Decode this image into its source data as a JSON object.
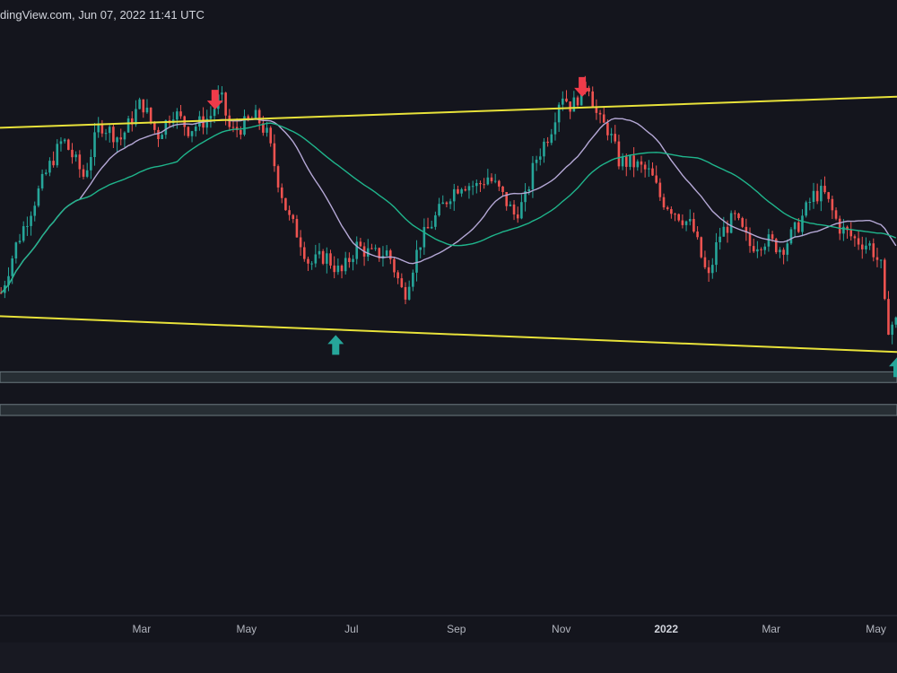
{
  "watermark": "dingView.com, Jun 07, 2022 11:41 UTC",
  "colors": {
    "background": "#14151d",
    "up": "#26a69a",
    "down": "#ef5350",
    "channel": "#e8e23a",
    "ma_fast": "#b5a8d6",
    "ma_slow": "#1fb58c",
    "zone": "#2a3338",
    "arrow_up": "#26a69a",
    "arrow_down": "#ef3b4a"
  },
  "chart_data": {
    "type": "candlestick",
    "title": "",
    "xlabel": "",
    "ylabel": "",
    "x_ticks": [
      {
        "label": "Mar",
        "t": 2.0,
        "bold": false
      },
      {
        "label": "May",
        "t": 4.0,
        "bold": false
      },
      {
        "label": "Jul",
        "t": 6.0,
        "bold": false
      },
      {
        "label": "Sep",
        "t": 8.0,
        "bold": false
      },
      {
        "label": "Nov",
        "t": 10.0,
        "bold": false
      },
      {
        "label": "2022",
        "t": 12.0,
        "bold": true
      },
      {
        "label": "Mar",
        "t": 14.0,
        "bold": false
      },
      {
        "label": "May",
        "t": 16.0,
        "bold": false
      }
    ],
    "x_range": [
      -0.7,
      16.4
    ],
    "y_range": [
      0,
      100
    ],
    "price_path": [
      [
        -0.7,
        20
      ],
      [
        -0.4,
        36
      ],
      [
        0.2,
        60
      ],
      [
        0.5,
        70
      ],
      [
        0.9,
        58
      ],
      [
        1.2,
        75
      ],
      [
        1.6,
        70
      ],
      [
        2.0,
        82
      ],
      [
        2.3,
        71
      ],
      [
        2.6,
        79
      ],
      [
        2.9,
        73
      ],
      [
        3.3,
        77
      ],
      [
        3.5,
        84
      ],
      [
        3.7,
        72
      ],
      [
        4.0,
        75
      ],
      [
        4.2,
        77
      ],
      [
        4.4,
        71
      ],
      [
        4.6,
        57
      ],
      [
        4.8,
        45
      ],
      [
        5.0,
        39
      ],
      [
        5.2,
        30
      ],
      [
        5.5,
        33
      ],
      [
        5.8,
        27
      ],
      [
        6.1,
        36
      ],
      [
        6.4,
        33
      ],
      [
        6.7,
        34
      ],
      [
        7.0,
        20
      ],
      [
        7.3,
        37
      ],
      [
        7.6,
        45
      ],
      [
        7.9,
        53
      ],
      [
        8.1,
        56
      ],
      [
        8.4,
        55
      ],
      [
        8.6,
        58
      ],
      [
        8.8,
        54
      ],
      [
        9.1,
        46
      ],
      [
        9.3,
        50
      ],
      [
        9.5,
        63
      ],
      [
        9.8,
        73
      ],
      [
        10.0,
        85
      ],
      [
        10.2,
        80
      ],
      [
        10.4,
        86
      ],
      [
        10.5,
        89
      ],
      [
        10.7,
        76
      ],
      [
        10.9,
        73
      ],
      [
        11.1,
        63
      ],
      [
        11.4,
        62
      ],
      [
        11.7,
        59
      ],
      [
        11.9,
        51
      ],
      [
        12.3,
        45
      ],
      [
        12.5,
        42
      ],
      [
        12.8,
        25
      ],
      [
        13.0,
        39
      ],
      [
        13.3,
        45
      ],
      [
        13.6,
        36
      ],
      [
        13.9,
        38
      ],
      [
        14.2,
        35
      ],
      [
        14.5,
        42
      ],
      [
        14.8,
        52
      ],
      [
        15.0,
        53
      ],
      [
        15.3,
        42
      ],
      [
        15.6,
        38
      ],
      [
        15.9,
        36
      ],
      [
        16.1,
        29
      ],
      [
        16.2,
        10
      ],
      [
        16.4,
        12
      ]
    ],
    "channel_upper": {
      "x": [
        -0.7,
        16.4
      ],
      "y": [
        73.6,
        83.5
      ]
    },
    "channel_lower": {
      "x": [
        -0.7,
        16.4
      ],
      "y": [
        13.6,
        2.2
      ]
    },
    "support_zones": [
      {
        "y_from": -4.1,
        "y_to": -7.5
      },
      {
        "y_from": -14.5,
        "y_to": -18.0
      }
    ],
    "markers": [
      {
        "type": "down",
        "t": 3.4
      },
      {
        "type": "down",
        "t": 10.4
      },
      {
        "type": "up",
        "t": 5.7
      },
      {
        "type": "up",
        "t": 16.4
      }
    ],
    "legend": "none",
    "grid": false
  }
}
